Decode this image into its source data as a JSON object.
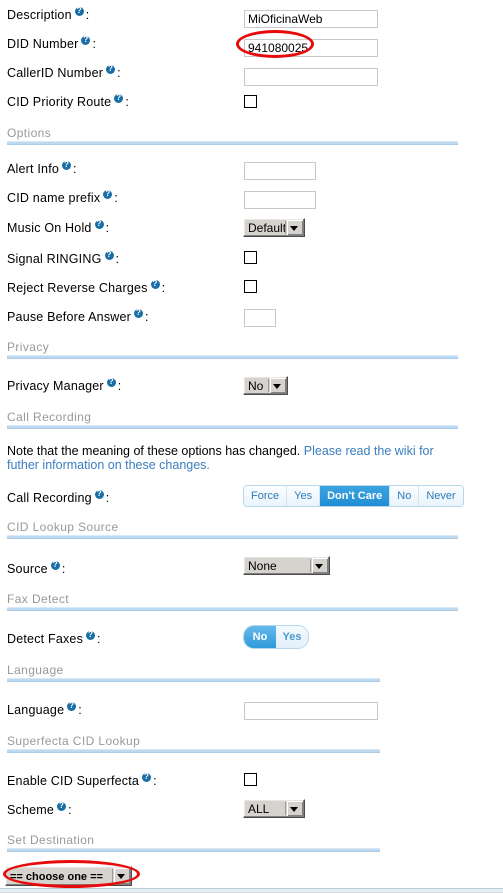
{
  "form": {
    "fields": [
      {
        "name": "description",
        "label": "Description",
        "colon": ":",
        "value": "MiOficinaWeb",
        "placeholder": ""
      },
      {
        "name": "did-number",
        "label": "DID Number",
        "colon": ":",
        "value": "941080025",
        "placeholder": ""
      },
      {
        "name": "callerid-number",
        "label": "CallerID Number",
        "colon": ":",
        "value": "",
        "placeholder": ""
      },
      {
        "name": "cid-priority-route",
        "label": "CID Priority Route",
        "colon": ":",
        "checked": false
      }
    ]
  },
  "sections": {
    "options": {
      "title": "Options",
      "fields": {
        "alert_info": {
          "label": "Alert Info",
          "colon": ":",
          "value": "",
          "placeholder": ""
        },
        "cid_name_prefix": {
          "label": "CID name prefix",
          "colon": ":",
          "value": "",
          "placeholder": ""
        },
        "music_on_hold": {
          "label": "Music On Hold",
          "colon": ":",
          "value": "Default"
        },
        "signal_ringing": {
          "label": "Signal RINGING",
          "colon": ":",
          "checked": false
        },
        "reject_reverse_charges": {
          "label": "Reject Reverse Charges",
          "colon": ":",
          "checked": false
        },
        "pause_before_answer": {
          "label": "Pause Before Answer",
          "colon": ":",
          "value": "",
          "placeholder": ""
        }
      }
    },
    "privacy": {
      "title": "Privacy",
      "fields": {
        "privacy_manager": {
          "label": "Privacy Manager",
          "colon": ":",
          "value": "No"
        }
      }
    },
    "call_recording": {
      "title": "Call Recording",
      "note_plain": "Note that the meaning of these options has changed. ",
      "note_link": "Please read the wiki for futher information on these changes.",
      "fields": {
        "call_recording": {
          "label": "Call Recording",
          "colon": ":",
          "options": [
            "Force",
            "Yes",
            "Don't Care",
            "No",
            "Never"
          ],
          "selected": "Don't Care"
        }
      }
    },
    "cid_lookup_source": {
      "title": "CID Lookup Source",
      "fields": {
        "source": {
          "label": "Source",
          "colon": ":",
          "value": "None"
        }
      }
    },
    "fax_detect": {
      "title": "Fax Detect",
      "fields": {
        "detect_faxes": {
          "label": "Detect Faxes",
          "colon": ":",
          "options": [
            "No",
            "Yes"
          ],
          "selected": "No"
        }
      }
    },
    "language": {
      "title": "Language",
      "fields": {
        "language": {
          "label": "Language",
          "colon": ":",
          "value": "",
          "placeholder": ""
        }
      }
    },
    "superfecta": {
      "title": "Superfecta CID Lookup",
      "fields": {
        "enable_cid_superfecta": {
          "label": "Enable CID Superfecta",
          "colon": ":",
          "checked": false
        },
        "scheme": {
          "label": "Scheme",
          "colon": ":",
          "value": "ALL"
        }
      }
    },
    "set_destination": {
      "title": "Set Destination",
      "fields": {
        "destination": {
          "value": "== choose one =="
        }
      }
    }
  },
  "colors": {
    "section_divider": "#bcd9ef",
    "section_title": "#999999",
    "link": "#3b7ebf",
    "accent_selected": "#1f8ed4",
    "annotation": "#e8090a",
    "help_bubble": "#1a6ea8"
  }
}
